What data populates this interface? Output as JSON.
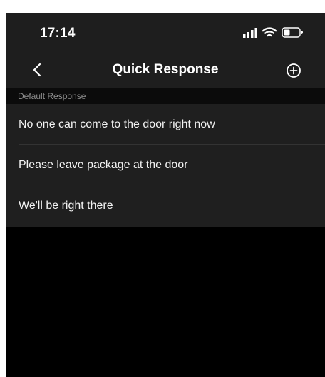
{
  "status_bar": {
    "time": "17:14",
    "icons": [
      "cellular-signal-icon",
      "wifi-icon",
      "battery-icon"
    ]
  },
  "nav_bar": {
    "back_icon": "chevron-left-icon",
    "title": "Quick Response",
    "add_icon": "plus-circle-icon"
  },
  "section": {
    "header": "Default Response"
  },
  "responses": [
    {
      "label": "No one can come to the door right now"
    },
    {
      "label": "Please leave package at the door"
    },
    {
      "label": "We'll be right there"
    }
  ],
  "colors": {
    "background": "#000000",
    "bar_background": "#1e1e1e",
    "list_background": "#1f1f1f",
    "text_primary": "#ffffff",
    "text_secondary": "#8f8f8f"
  }
}
